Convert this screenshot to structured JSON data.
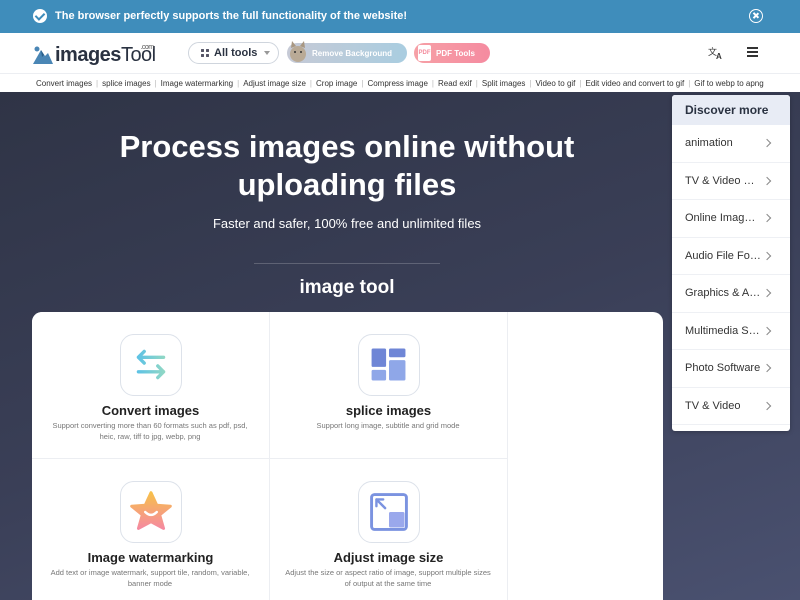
{
  "notice": {
    "text": "The browser perfectly supports the full functionality of the website!"
  },
  "header": {
    "logo_text": "images",
    "logo_text_2": "Tool",
    "logo_com": ".com",
    "all_tools_label": "All tools",
    "remove_bg_label": "Remove Background",
    "pdf_tools_label": "PDF Tools"
  },
  "links": [
    "Convert images",
    "splice images",
    "Image watermarking",
    "Adjust image size",
    "Crop image",
    "Compress image",
    "Read exif",
    "Split images",
    "Video to gif",
    "Edit video and convert to gif",
    "Gif to webp to apng"
  ],
  "hero": {
    "title_line1": "Process images online without",
    "title_line2": "uploading files",
    "subtitle": "Faster and safer, 100% free and unlimited files",
    "section_title": "image tool"
  },
  "cards": [
    {
      "title": "Convert images",
      "desc": "Support converting more than 60 formats such as pdf, psd, heic, raw, tiff to jpg, webp, png",
      "icon": "convert-arrows-icon"
    },
    {
      "title": "splice images",
      "desc": "Support long image, subtitle and grid mode",
      "icon": "splice-grid-icon"
    },
    {
      "title": "Image watermarking",
      "desc": "Add text or image watermark, support tile, random, variable, banner mode",
      "icon": "watermark-star-icon"
    },
    {
      "title": "Adjust image size",
      "desc": "Adjust the size or aspect ratio of image, support multiple sizes of output at the same time",
      "icon": "resize-icon"
    }
  ],
  "discover": {
    "title": "Discover more",
    "items": [
      "animation",
      "TV & Video Editing",
      "Online Image Editors",
      "Audio File Formats",
      "Graphics & Animation",
      "Multimedia Software",
      "Photo Software",
      "TV & Video"
    ]
  },
  "colors": {
    "notice_bg": "#3f8dbb",
    "hero_bg": "#343a50",
    "pdf_accent": "#f58ba0",
    "splice_accent": "#6f86d6"
  }
}
